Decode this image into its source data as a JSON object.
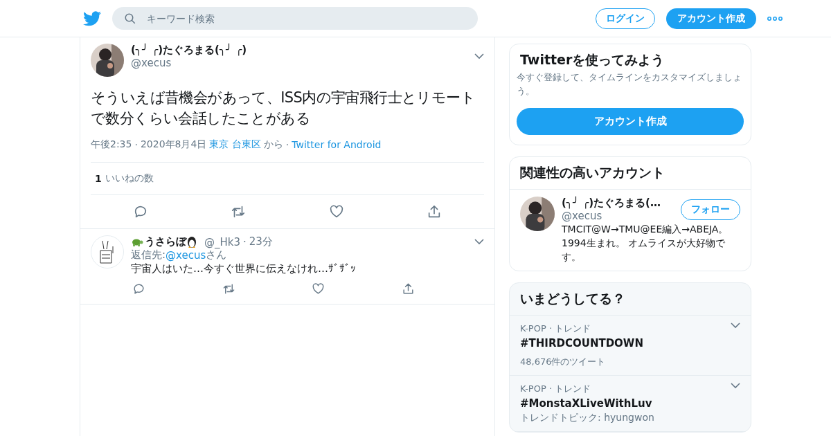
{
  "header": {
    "search": {
      "placeholder": "キーワード検索"
    },
    "login": "ログイン",
    "signup": "アカウント作成"
  },
  "tweet": {
    "name": "(╮╯ ╭)たぐろまる(╮╯ ╭)",
    "handle": "@xecus",
    "text": "そういえば昔機会があって、ISS内の宇宙飛行士とリモートで数分くらい会話したことがある",
    "time": "午後2:35",
    "separator": "·",
    "date": "2020年8月4日",
    "place": "東京 台東区",
    "place_suffix": "から",
    "client": "Twitter for Android",
    "like_count": "1",
    "like_label": "いいねの数"
  },
  "replies": [
    {
      "name": "うさらぼ",
      "handle": "@_Hk3",
      "separator": "·",
      "time": "23分",
      "reply_prefix": "返信先: ",
      "reply_to": "@xecus",
      "reply_suffix": "さん",
      "text": "宇宙人はいた…今すぐ世界に伝えなけれ…ｻﾞｻﾞｯ"
    }
  ],
  "signup_card": {
    "title": "Twitterを使ってみよう",
    "text": "今すぐ登録して、タイムラインをカスタマイズしましょう。",
    "button": "アカウント作成"
  },
  "related": {
    "title": "関連性の高いアカウント",
    "accounts": [
      {
        "name": "(╮╯ ╭)たぐろまる(…",
        "handle": "@xecus",
        "follow": "フォロー",
        "bio": "TMCIT@W→TMU@EE編入→ABEJA。1994生まれ。 オムライスが大好物です。"
      }
    ]
  },
  "trends": {
    "title": "いまどうしてる？",
    "items": [
      {
        "context": "K-POP · トレンド",
        "name": "#THIRDCOUNTDOWN",
        "count": "48,676件のツイート"
      },
      {
        "context": "K-POP · トレンド",
        "name": "#MonstaXLiveWithLuv",
        "topic": "トレンドトピック: hyungwon"
      }
    ]
  }
}
